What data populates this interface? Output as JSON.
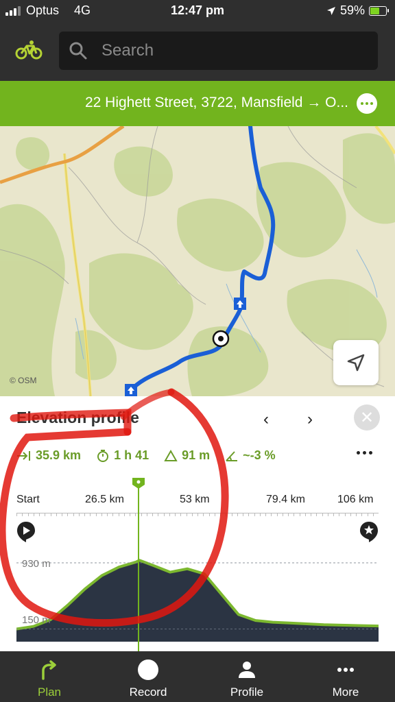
{
  "status_bar": {
    "carrier": "Optus",
    "network": "4G",
    "time": "12:47 pm",
    "battery": "59%",
    "battery_level": 0.59
  },
  "search": {
    "placeholder": "Search"
  },
  "route": {
    "title": "22 Highett Street, 3722, Mansfield → O..."
  },
  "map": {
    "attribution": "© OSM"
  },
  "elevation_panel": {
    "title": "Elevation profile",
    "prev": "‹",
    "next": "›",
    "close": "✕",
    "stats": {
      "distance": "35.9 km",
      "duration": "1 h 41",
      "elevation": "91 m",
      "slope": "~-3 %"
    },
    "ticks": [
      "Start",
      "26.5 km",
      "53 km",
      "79.4 km",
      "106 km"
    ],
    "grid_labels": [
      "930 m",
      "150 m"
    ],
    "marker_position": 0.338
  },
  "chart_data": {
    "type": "area",
    "x": [
      0,
      5,
      10,
      15,
      20,
      25,
      30,
      35,
      36,
      40,
      45,
      50,
      55,
      60,
      65,
      70,
      75,
      80,
      85,
      90,
      95,
      100,
      106
    ],
    "y": [
      150,
      180,
      260,
      430,
      620,
      780,
      880,
      940,
      960,
      900,
      820,
      860,
      800,
      560,
      320,
      250,
      230,
      220,
      210,
      200,
      195,
      190,
      185
    ],
    "xlabel": "",
    "ylabel": "",
    "ylim": [
      0,
      1100
    ],
    "xlim": [
      0,
      106
    ],
    "colors": {
      "fill": "#2b3443",
      "line": "#7cb82f"
    }
  },
  "bottom_nav": {
    "items": [
      {
        "label": "Plan",
        "icon": "plan-arrow-icon"
      },
      {
        "label": "Record",
        "icon": "record-icon"
      },
      {
        "label": "Profile",
        "icon": "person-icon"
      },
      {
        "label": "More",
        "icon": "more-icon"
      }
    ]
  },
  "colors": {
    "accent": "#72b41e",
    "dark": "#2f2f2f",
    "route_line": "#1a5fd6",
    "annotation": "#e0180f"
  }
}
